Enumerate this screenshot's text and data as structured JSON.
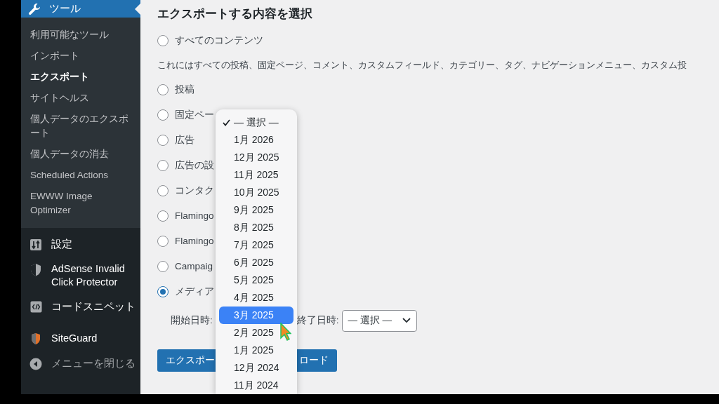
{
  "sidebar": {
    "header": {
      "label": "ツール"
    },
    "submenu": [
      {
        "label": "利用可能なツール",
        "selected": false
      },
      {
        "label": "インポート",
        "selected": false
      },
      {
        "label": "エクスポート",
        "selected": true
      },
      {
        "label": "サイトヘルス",
        "selected": false
      },
      {
        "label": "個人データのエクスポート",
        "selected": false
      },
      {
        "label": "個人データの消去",
        "selected": false
      },
      {
        "label": "Scheduled Actions",
        "selected": false
      },
      {
        "label": "EWWW Image Optimizer",
        "selected": false
      }
    ],
    "menu": [
      {
        "label": "設定",
        "kind": "sliders"
      },
      {
        "label": "AdSense Invalid Click Protector",
        "kind": "shield"
      },
      {
        "label": "コードスニペット",
        "kind": "code"
      },
      {
        "label": "SiteGuard",
        "kind": "guard"
      },
      {
        "label": "メニューを閉じる",
        "kind": "collapse"
      }
    ]
  },
  "main": {
    "heading": "エクスポートする内容を選択",
    "options": [
      {
        "label": "すべてのコンテンツ",
        "selected": false,
        "description": "これにはすべての投稿、固定ページ、コメント、カスタムフィールド、カテゴリー、タグ、ナビゲーションメニュー、カスタム投"
      },
      {
        "label": "投稿",
        "selected": false
      },
      {
        "label": "固定ペー",
        "selected": false
      },
      {
        "label": "広告",
        "selected": false
      },
      {
        "label": "広告の設",
        "selected": false
      },
      {
        "label": "コンタク",
        "selected": false
      },
      {
        "label": "Flamingo",
        "selected": false
      },
      {
        "label": "Flamingo",
        "selected": false
      },
      {
        "label": "Campaig",
        "selected": false
      },
      {
        "label": "メディア",
        "selected": true
      }
    ],
    "date_filter": {
      "start_label": "開始日時:",
      "end_label": "終了日時:",
      "end_value": "— 選択 —"
    },
    "button": {
      "visible_start": "エクスポー",
      "visible_end": "ロード"
    }
  },
  "dropdown": {
    "items": [
      {
        "label": "— 選択 —",
        "checked": true,
        "highlighted": false
      },
      {
        "label": "1月 2026",
        "checked": false,
        "highlighted": false
      },
      {
        "label": "12月 2025",
        "checked": false,
        "highlighted": false
      },
      {
        "label": "11月 2025",
        "checked": false,
        "highlighted": false
      },
      {
        "label": "10月 2025",
        "checked": false,
        "highlighted": false
      },
      {
        "label": "9月 2025",
        "checked": false,
        "highlighted": false
      },
      {
        "label": "8月 2025",
        "checked": false,
        "highlighted": false
      },
      {
        "label": "7月 2025",
        "checked": false,
        "highlighted": false
      },
      {
        "label": "6月 2025",
        "checked": false,
        "highlighted": false
      },
      {
        "label": "5月 2025",
        "checked": false,
        "highlighted": false
      },
      {
        "label": "4月 2025",
        "checked": false,
        "highlighted": false
      },
      {
        "label": "3月 2025",
        "checked": false,
        "highlighted": true
      },
      {
        "label": "2月 2025",
        "checked": false,
        "highlighted": false
      },
      {
        "label": "1月 2025",
        "checked": false,
        "highlighted": false
      },
      {
        "label": "12月 2024",
        "checked": false,
        "highlighted": false
      },
      {
        "label": "11月 2024",
        "checked": false,
        "highlighted": false
      }
    ]
  }
}
